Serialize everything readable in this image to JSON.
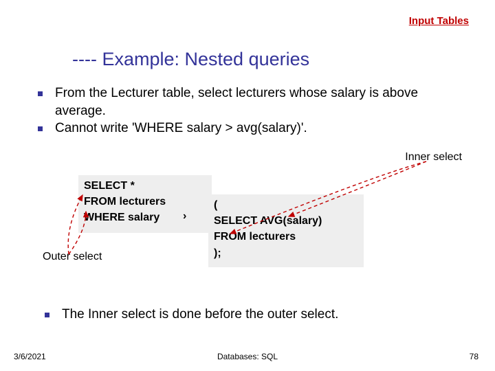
{
  "top_link": "Input Tables",
  "title": "---- Example: Nested queries",
  "bullets": [
    "From the Lecturer table, select lecturers whose salary is above average.",
    "Cannot write 'WHERE salary > avg(salary)'."
  ],
  "inner_label": "Inner select",
  "outer_label": "Outer select",
  "code_outer": {
    "l1": "SELECT *",
    "l2": "FROM lecturers",
    "l3": "WHERE salary",
    "gt": "›"
  },
  "code_inner": {
    "l1": "(",
    "l2": " SELECT AVG(salary)",
    "l3": " FROM lecturers",
    "l4": ");"
  },
  "bullet2": "The Inner select is done before the outer select.",
  "footer": {
    "left": "3/6/2021",
    "center": "Databases: SQL",
    "right": "78"
  }
}
